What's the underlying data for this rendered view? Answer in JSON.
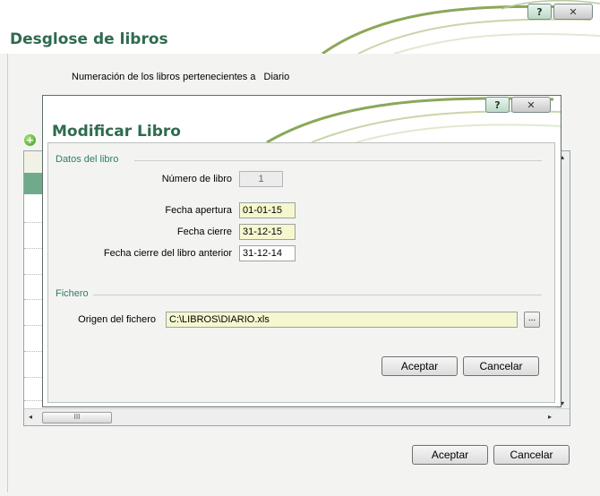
{
  "outer_window": {
    "title": "Desglose de libros",
    "help_button": "?",
    "close_button": "✕",
    "numeracion_label": "Numeración de los libros pertenecientes a",
    "numeracion_value": "Diario",
    "add_icon": "add-icon",
    "grid": {
      "scroll_thumb_glyph": "III",
      "left_arrow": "◂",
      "right_arrow": "▸",
      "up_arrow": "▴",
      "down_arrow": "▾"
    },
    "accept_label": "Aceptar",
    "cancel_label": "Cancelar"
  },
  "dialog": {
    "title": "Modificar Libro",
    "help_button": "?",
    "close_button": "✕",
    "datos_section": "Datos del libro",
    "numero_label": "Número de libro",
    "numero_value": "1",
    "apertura_label": "Fecha apertura",
    "apertura_value": "01-01-15",
    "cierre_label": "Fecha cierre",
    "cierre_value": "31-12-15",
    "cierre_anterior_label": "Fecha cierre del libro anterior",
    "cierre_anterior_value": "31-12-14",
    "fichero_section": "Fichero",
    "origen_label": "Origen del fichero",
    "origen_value": "C:\\LIBROS\\DIARIO.xls",
    "browse_label": "...",
    "accept_label": "Aceptar",
    "cancel_label": "Cancelar"
  },
  "colors": {
    "title_green": "#2f6b4f",
    "section_teal": "#2f7a6c",
    "field_yellow": "#f6f7cf",
    "selected_row": "#6faa8c"
  }
}
